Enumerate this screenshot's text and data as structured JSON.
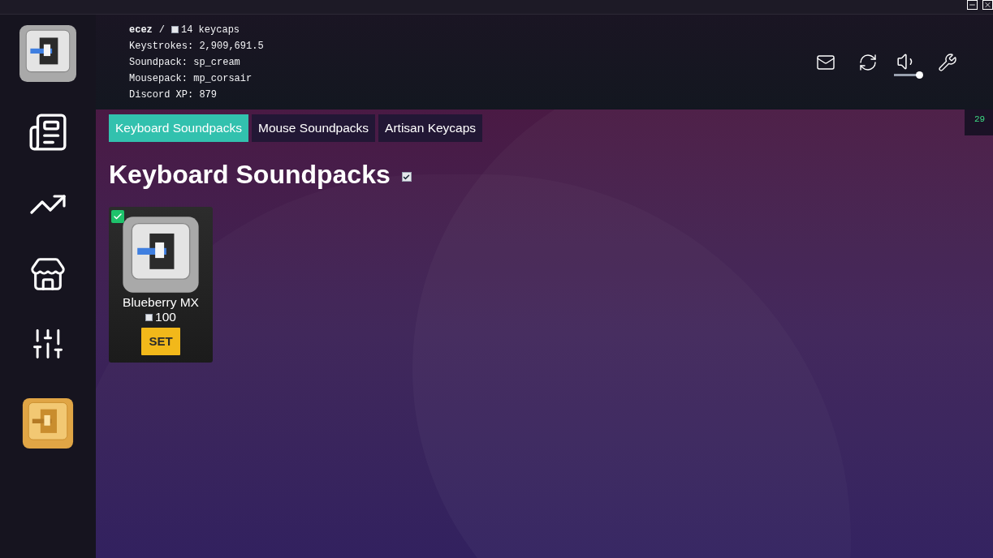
{
  "header": {
    "user": "ecez",
    "separator": "/",
    "keycaps": "14 keycaps",
    "stats": [
      "Keystrokes: 2,909,691.5",
      "Soundpack: sp_cream",
      "Mousepack: mp_corsair",
      "Discord XP: 879"
    ],
    "volume": {
      "level": 1
    }
  },
  "counter": "29",
  "tabs": [
    {
      "label": "Keyboard Soundpacks",
      "selected": true
    },
    {
      "label": "Mouse Soundpacks",
      "selected": false
    },
    {
      "label": "Artisan Keycaps",
      "selected": false
    }
  ],
  "section": {
    "title": "Keyboard Soundpacks",
    "checked": true
  },
  "cards": [
    {
      "name": "Blueberry MX",
      "price": "100",
      "selected": true,
      "button": "SET"
    }
  ]
}
